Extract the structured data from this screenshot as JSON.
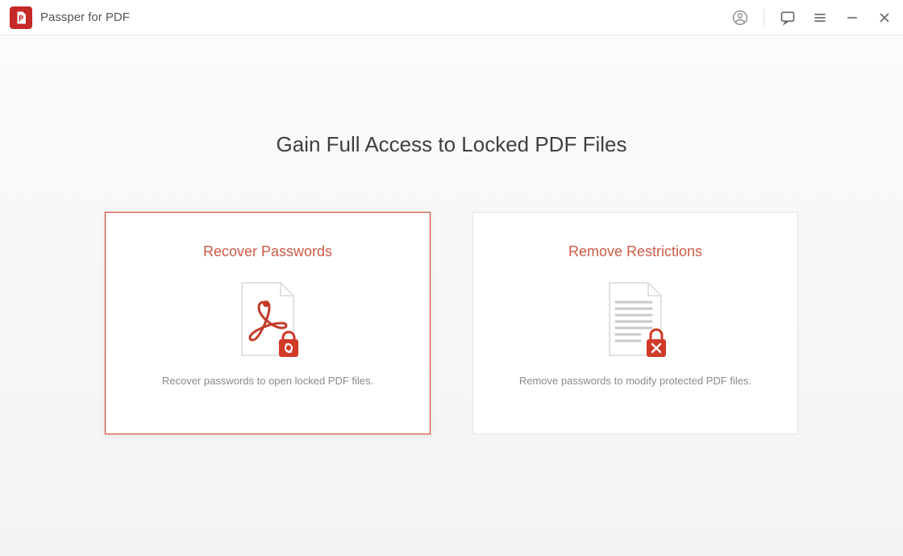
{
  "titlebar": {
    "app_title": "Passper for PDF"
  },
  "main": {
    "headline": "Gain Full Access to Locked PDF Files",
    "cards": {
      "recover": {
        "title": "Recover Passwords",
        "desc": "Recover passwords to open locked PDF files."
      },
      "remove": {
        "title": "Remove Restrictions",
        "desc": "Remove passwords to modify protected PDF files."
      }
    }
  }
}
